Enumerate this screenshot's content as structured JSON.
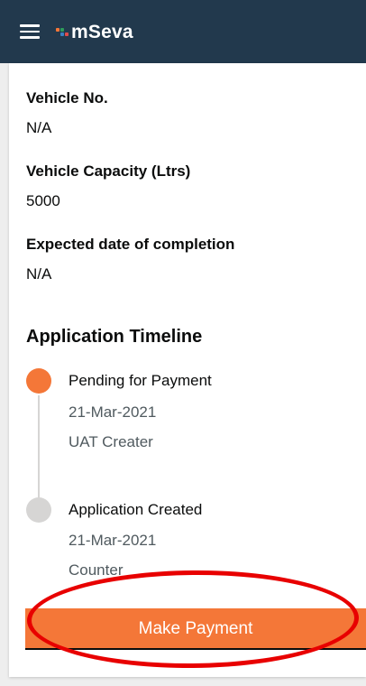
{
  "header": {
    "app_name": "mSeva",
    "menu_icon": "hamburger-menu-icon",
    "background_color": "#22394d",
    "logo_colors": [
      "#f47738",
      "#2e9b5a",
      "#3b82c4",
      "#e04b4b"
    ]
  },
  "details": {
    "fields": [
      {
        "label": "Vehicle No.",
        "value": "N/A"
      },
      {
        "label": "Vehicle Capacity (Ltrs)",
        "value": "5000"
      },
      {
        "label": "Expected date of completion",
        "value": "N/A"
      }
    ]
  },
  "timeline": {
    "title": "Application Timeline",
    "steps": [
      {
        "status": "Pending for Payment",
        "date": "21-Mar-2021",
        "actor": "UAT Creater",
        "active": true
      },
      {
        "status": "Application Created",
        "date": "21-Mar-2021",
        "actor": "Counter",
        "active": false
      }
    ],
    "active_color": "#f47738",
    "inactive_color": "#d6d5d4"
  },
  "actions": {
    "primary_label": "Make Payment",
    "primary_color": "#f47738"
  },
  "annotation": {
    "highlight_color": "#e80000"
  }
}
